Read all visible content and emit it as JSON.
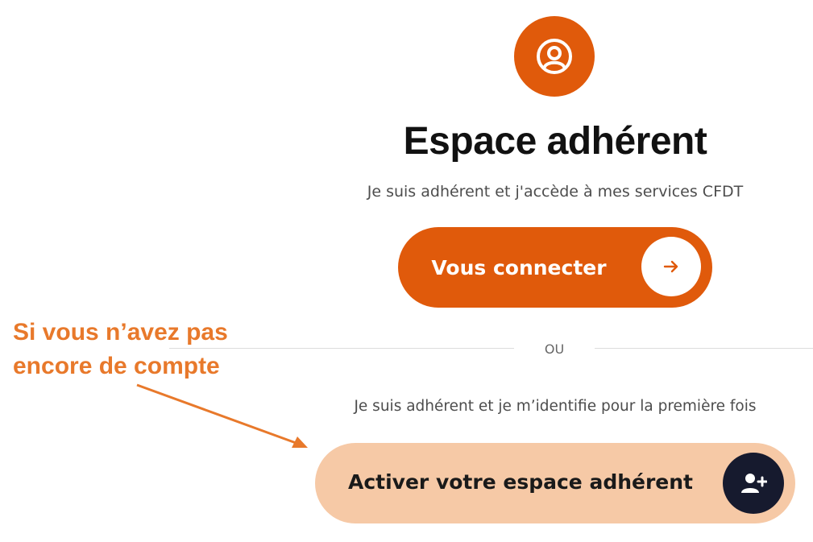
{
  "header": {
    "title": "Espace adhérent",
    "subtitle": "Je suis adhérent et j'accède à mes services CFDT"
  },
  "connect_button": {
    "label": "Vous connecter",
    "icon": "arrow-right-icon"
  },
  "divider": {
    "label": "OU"
  },
  "activation": {
    "subtitle": "Je suis adhérent et je m’identifie pour la première fois",
    "button_label": "Activer votre espace adhérent",
    "icon": "add-user-icon"
  },
  "annotation": {
    "line1": "Si vous n’avez pas",
    "line2": "encore de compte"
  },
  "colors": {
    "primary": "#e05a0b",
    "secondary_bg": "#f6c9a6",
    "dark_circle": "#161a2e",
    "annotation": "#e8792b"
  }
}
